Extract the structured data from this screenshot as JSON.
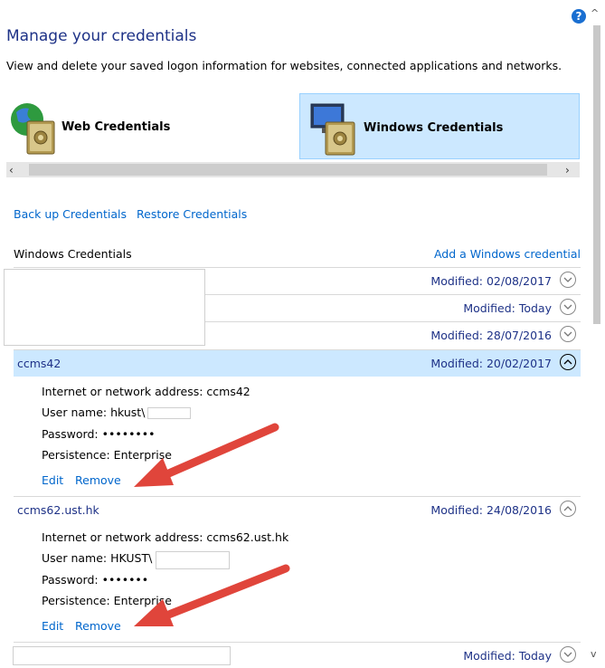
{
  "page": {
    "title": "Manage your credentials",
    "subtitle": "View and delete your saved logon information for websites, connected applications and networks.",
    "help_icon": "?"
  },
  "tiles": [
    {
      "label": "Web Credentials",
      "icon": "vault-globe-icon",
      "selected": false
    },
    {
      "label": "Windows Credentials",
      "icon": "vault-computer-icon",
      "selected": true
    }
  ],
  "links": {
    "backup": "Back up Credentials",
    "restore": "Restore Credentials",
    "add": "Add a Windows credential"
  },
  "section_title": "Windows Credentials",
  "credentials": [
    {
      "name": "",
      "modified": "Modified:  02/08/2017",
      "expanded": false
    },
    {
      "name": "",
      "modified": "Modified:  Today",
      "expanded": false
    },
    {
      "name": "",
      "modified": "Modified:  28/07/2016",
      "expanded": false
    },
    {
      "name": "ccms42",
      "modified": "Modified:  20/02/2017",
      "expanded": true,
      "selected": true,
      "details": {
        "address": "Internet or network address:  ccms42",
        "username": "User name:  hkust\\",
        "password": "Password:  ••••••••",
        "persistence": "Persistence:  Enterprise",
        "edit": "Edit",
        "remove": "Remove"
      }
    },
    {
      "name": "ccms62.ust.hk",
      "modified": "Modified:  24/08/2016",
      "expanded": true,
      "details": {
        "address": "Internet or network address:  ccms62.ust.hk",
        "username": "User name:  HKUST\\",
        "password": "Password:  •••••••",
        "persistence": "Persistence:  Enterprise",
        "edit": "Edit",
        "remove": "Remove"
      }
    },
    {
      "name": "",
      "modified": "Modified:  Today",
      "expanded": false
    }
  ],
  "colors": {
    "title": "#1e3287",
    "link": "#0066cc",
    "selection": "#cce8ff",
    "arrow": "#e0453b"
  }
}
